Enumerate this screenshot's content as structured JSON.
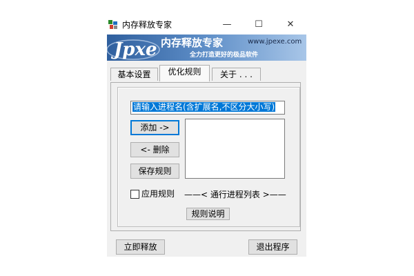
{
  "window": {
    "title": "内存释放专家",
    "minimize": "—",
    "maximize": "☐",
    "close": "✕"
  },
  "banner": {
    "logo_text": "Jpxe",
    "headline": "内存释放专家",
    "url": "www.jpexe.com",
    "slogan": "全力打造更好的极品软件"
  },
  "tabs": [
    {
      "label": "基本设置"
    },
    {
      "label": "优化规则"
    },
    {
      "label": "关于 . . ."
    }
  ],
  "rules": {
    "process_input_value": "请输入进程名(含扩展名,不区分大小写)",
    "add_button": "添加 ->",
    "delete_button": "<- 删除",
    "save_button": "保存规则",
    "apply_checkbox_label": "应用规则",
    "apply_checked": false,
    "list_caption": "——< 通行进程列表 >——",
    "help_button": "规则说明"
  },
  "footer": {
    "release_button": "立即释放",
    "exit_button": "退出程序"
  }
}
